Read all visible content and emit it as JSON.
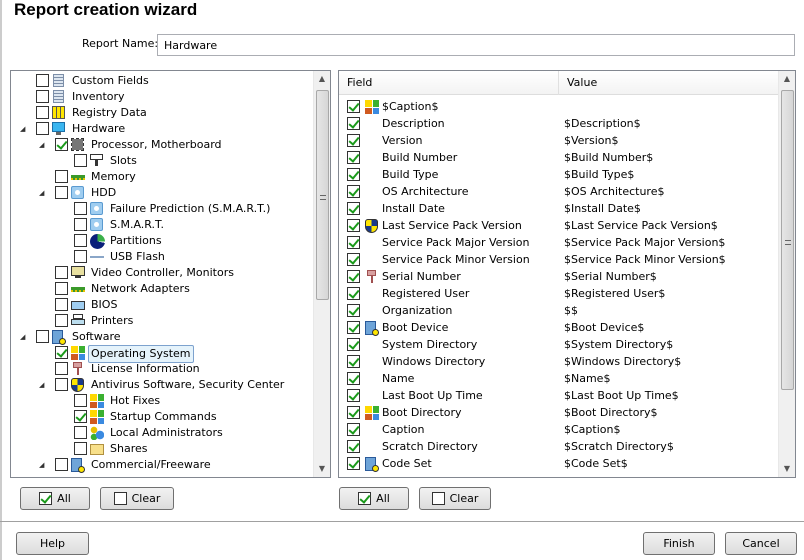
{
  "title": "Report creation wizard",
  "report_name": {
    "label": "Report Name:",
    "value": "Hardware"
  },
  "tree": [
    {
      "label": "Custom Fields",
      "level": 0,
      "checked": false,
      "icon": "document-icon",
      "expand": false
    },
    {
      "label": "Inventory",
      "level": 0,
      "checked": false,
      "icon": "document-icon",
      "expand": false
    },
    {
      "label": "Registry Data",
      "level": 0,
      "checked": false,
      "icon": "registry-grid-icon",
      "expand": false
    },
    {
      "label": "Hardware",
      "level": 0,
      "checked": false,
      "icon": "monitor-icon",
      "expand": true
    },
    {
      "label": "Processor, Motherboard",
      "level": 1,
      "checked": true,
      "icon": "cpu-icon",
      "expand": true
    },
    {
      "label": "Slots",
      "level": 2,
      "checked": false,
      "icon": "slot-icon",
      "expand": false
    },
    {
      "label": "Memory",
      "level": 1,
      "checked": false,
      "icon": "memory-icon",
      "expand": false
    },
    {
      "label": "HDD",
      "level": 1,
      "checked": false,
      "icon": "disk-icon",
      "expand": true
    },
    {
      "label": "Failure Prediction (S.M.A.R.T.)",
      "level": 2,
      "checked": false,
      "icon": "disk-icon",
      "expand": false
    },
    {
      "label": "S.M.A.R.T.",
      "level": 2,
      "checked": false,
      "icon": "disk-icon",
      "expand": false
    },
    {
      "label": "Partitions",
      "level": 2,
      "checked": false,
      "icon": "pie-icon",
      "expand": false
    },
    {
      "label": "USB Flash",
      "level": 2,
      "checked": false,
      "icon": "usb-icon",
      "expand": false
    },
    {
      "label": "Video Controller, Monitors",
      "level": 1,
      "checked": false,
      "icon": "display-icon",
      "expand": false
    },
    {
      "label": "Network Adapters",
      "level": 1,
      "checked": false,
      "icon": "network-card-icon",
      "expand": false
    },
    {
      "label": "BIOS",
      "level": 1,
      "checked": false,
      "icon": "chip-icon",
      "expand": false
    },
    {
      "label": "Printers",
      "level": 1,
      "checked": false,
      "icon": "printer-icon",
      "expand": false
    },
    {
      "label": "Software",
      "level": 0,
      "checked": false,
      "icon": "software-icon",
      "expand": true
    },
    {
      "label": "Operating System",
      "level": 1,
      "checked": true,
      "icon": "windows-icon",
      "expand": false,
      "selected": true
    },
    {
      "label": "License Information",
      "level": 1,
      "checked": false,
      "icon": "key-icon",
      "expand": false
    },
    {
      "label": "Antivirus Software, Security Center",
      "level": 1,
      "checked": false,
      "icon": "shield-icon",
      "expand": true
    },
    {
      "label": "Hot Fixes",
      "level": 2,
      "checked": false,
      "icon": "windows-icon",
      "expand": false
    },
    {
      "label": "Startup Commands",
      "level": 2,
      "checked": true,
      "icon": "windows-icon",
      "expand": false
    },
    {
      "label": "Local Administrators",
      "level": 2,
      "checked": false,
      "icon": "users-icon",
      "expand": false
    },
    {
      "label": "Shares",
      "level": 2,
      "checked": false,
      "icon": "folder-icon",
      "expand": false
    },
    {
      "label": "Commercial/Freeware",
      "level": 1,
      "checked": false,
      "icon": "software-icon",
      "expand": true
    }
  ],
  "list": {
    "headers": {
      "field": "Field",
      "value": "Value"
    },
    "rows": [
      {
        "field": "$Caption$",
        "value": "",
        "icon": "windows-icon"
      },
      {
        "field": "Description",
        "value": "$Description$"
      },
      {
        "field": "Version",
        "value": "$Version$"
      },
      {
        "field": "Build Number",
        "value": "$Build Number$"
      },
      {
        "field": "Build Type",
        "value": "$Build Type$"
      },
      {
        "field": "OS Architecture",
        "value": "$OS Architecture$"
      },
      {
        "field": "Install Date",
        "value": "$Install Date$"
      },
      {
        "field": "Last Service Pack Version",
        "value": "$Last Service Pack Version$",
        "icon": "shield-icon"
      },
      {
        "field": "Service Pack Major Version",
        "value": "$Service Pack Major Version$"
      },
      {
        "field": "Service Pack Minor Version",
        "value": "$Service Pack Minor Version$"
      },
      {
        "field": "Serial Number",
        "value": "$Serial Number$",
        "icon": "key-icon"
      },
      {
        "field": "Registered User",
        "value": "$Registered User$"
      },
      {
        "field": "Organization",
        "value": "$$"
      },
      {
        "field": "Boot Device",
        "value": "$Boot Device$",
        "icon": "software-icon"
      },
      {
        "field": "System Directory",
        "value": "$System Directory$"
      },
      {
        "field": "Windows Directory",
        "value": "$Windows Directory$"
      },
      {
        "field": "Name",
        "value": "$Name$"
      },
      {
        "field": "Last Boot Up Time",
        "value": "$Last Boot Up Time$"
      },
      {
        "field": "Boot Directory",
        "value": "$Boot Directory$",
        "icon": "windows-icon"
      },
      {
        "field": "Caption",
        "value": "$Caption$"
      },
      {
        "field": "Scratch Directory",
        "value": "$Scratch Directory$"
      },
      {
        "field": "Code Set",
        "value": "$Code Set$",
        "icon": "software-icon"
      }
    ]
  },
  "buttons": {
    "all": "All",
    "clear": "Clear",
    "help": "Help",
    "finish": "Finish",
    "cancel": "Cancel"
  }
}
